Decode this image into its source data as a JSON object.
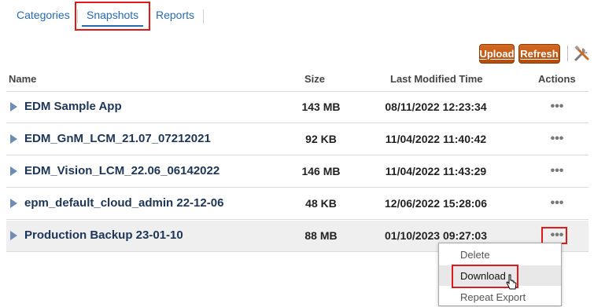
{
  "tabs": [
    {
      "label": "Categories"
    },
    {
      "label": "Snapshots",
      "active": true
    },
    {
      "label": "Reports"
    }
  ],
  "toolbar": {
    "upload_label": "Upload",
    "refresh_label": "Refresh",
    "tools_icon": "tools-icon",
    "button_color": "#c25a15"
  },
  "table": {
    "headers": {
      "name": "Name",
      "size": "Size",
      "modified": "Last Modified Time",
      "actions": "Actions"
    },
    "rows": [
      {
        "name": "EDM Sample App",
        "size": "143 MB",
        "modified": "08/11/2022 12:23:34",
        "actions": "•••"
      },
      {
        "name": "EDM_GnM_LCM_21.07_07212021",
        "size": "92 KB",
        "modified": "11/04/2022 11:40:42",
        "actions": "•••"
      },
      {
        "name": "EDM_Vision_LCM_22.06_06142022",
        "size": "146 MB",
        "modified": "11/04/2022 11:43:29",
        "actions": "•••"
      },
      {
        "name": "epm_default_cloud_admin 22-12-06",
        "size": "48 KB",
        "modified": "12/06/2022 15:28:06",
        "actions": "•••"
      },
      {
        "name": "Production Backup 23-01-10",
        "size": "88 MB",
        "modified": "01/10/2023 09:27:03",
        "actions": "•••",
        "selected": true
      }
    ]
  },
  "context_menu": {
    "items": [
      {
        "label": "Delete"
      },
      {
        "label": "Download",
        "hovered": true
      },
      {
        "label": "Repeat Export"
      }
    ]
  },
  "colors": {
    "link": "#2a6ab0",
    "highlight": "#e0191b",
    "row_name": "#1d3557"
  }
}
